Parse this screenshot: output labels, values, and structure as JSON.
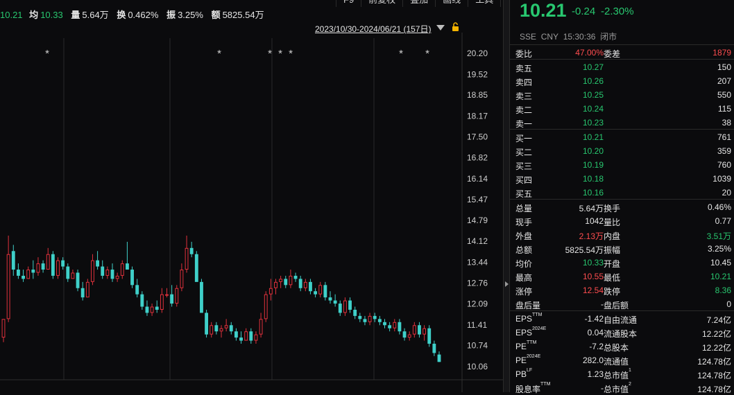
{
  "toolbar": [
    "F9",
    "前复权",
    "叠加",
    "画线",
    "工具",
    ">>"
  ],
  "stats_bar": {
    "last_value": "10.21",
    "avg_label": "均",
    "avg_value": "10.33",
    "vol_label": "量",
    "vol_value": "5.64万",
    "turnover_label": "换",
    "turnover_value": "0.462%",
    "amplitude_label": "振",
    "amplitude_value": "3.25%",
    "amount_label": "额",
    "amount_value": "5825.54万"
  },
  "date_range": "2023/10/30-2024/06/21 (157日)",
  "quote": {
    "price": "10.21",
    "change": "-0.24",
    "change_pct": "-2.30%",
    "exchange": "SSE",
    "currency": "CNY",
    "time": "15:30:36",
    "status": "闭市"
  },
  "order_book": {
    "ratio_label": "委比",
    "ratio_value": "47.00%",
    "diff_label": "委差",
    "diff_value": "1879",
    "asks": [
      {
        "label": "卖五",
        "price": "10.27",
        "volume": "150"
      },
      {
        "label": "卖四",
        "price": "10.26",
        "volume": "207"
      },
      {
        "label": "卖三",
        "price": "10.25",
        "volume": "550"
      },
      {
        "label": "卖二",
        "price": "10.24",
        "volume": "115"
      },
      {
        "label": "卖一",
        "price": "10.23",
        "volume": "38"
      }
    ],
    "bids": [
      {
        "label": "买一",
        "price": "10.21",
        "volume": "761"
      },
      {
        "label": "买二",
        "price": "10.20",
        "volume": "359"
      },
      {
        "label": "买三",
        "price": "10.19",
        "volume": "760"
      },
      {
        "label": "买四",
        "price": "10.18",
        "volume": "1039"
      },
      {
        "label": "买五",
        "price": "10.16",
        "volume": "20"
      }
    ]
  },
  "stats": [
    {
      "l1": "总量",
      "v1": "5.64万",
      "c1": "wh",
      "l2": "换手",
      "v2": "0.46%",
      "c2": "wh"
    },
    {
      "l1": "现手",
      "v1": "1042",
      "c1": "wh",
      "l2": "量比",
      "v2": "0.77",
      "c2": "wh"
    },
    {
      "l1": "外盘",
      "v1": "2.13万",
      "c1": "rd",
      "l2": "内盘",
      "v2": "3.51万",
      "c2": "gr"
    },
    {
      "l1": "总额",
      "v1": "5825.54万",
      "c1": "wh",
      "l2": "振幅",
      "v2": "3.25%",
      "c2": "wh"
    },
    {
      "l1": "均价",
      "v1": "10.33",
      "c1": "gr",
      "l2": "开盘",
      "v2": "10.45",
      "c2": "wh"
    },
    {
      "l1": "最高",
      "v1": "10.55",
      "c1": "rd",
      "l2": "最低",
      "v2": "10.21",
      "c2": "gr"
    },
    {
      "l1": "涨停",
      "v1": "12.54",
      "c1": "rd",
      "l2": "跌停",
      "v2": "8.36",
      "c2": "gr"
    },
    {
      "l1": "盘后量",
      "v1": "-",
      "c1": "wh",
      "l2": "盘后额",
      "v2": "0",
      "c2": "wh"
    }
  ],
  "fundamentals": [
    {
      "l1": "EPS",
      "s1": "TTM",
      "v1": "-1.42",
      "l2": "自由流通",
      "s2": "",
      "v2": "7.24亿"
    },
    {
      "l1": "EPS",
      "s1": "2024E",
      "v1": "0.04",
      "l2": "流通股本",
      "s2": "",
      "v2": "12.22亿"
    },
    {
      "l1": "PE",
      "s1": "TTM",
      "v1": "-7.2",
      "l2": "总股本",
      "s2": "",
      "v2": "12.22亿"
    },
    {
      "l1": "PE",
      "s1": "2024E",
      "v1": "282.0",
      "l2": "流通值",
      "s2": "",
      "v2": "124.78亿"
    },
    {
      "l1": "PB",
      "s1": "LF",
      "v1": "1.23",
      "l2": "总市值",
      "s2": "1",
      "v2": "124.78亿"
    },
    {
      "l1": "股息率",
      "s1": "TTM",
      "v1": "-",
      "l2": "总市值",
      "s2": "2",
      "v2": "124.78亿"
    }
  ],
  "chart_data": {
    "type": "candlestick",
    "y_ticks": [
      "20.20",
      "19.52",
      "18.85",
      "18.17",
      "17.50",
      "16.82",
      "16.14",
      "15.47",
      "14.79",
      "14.12",
      "13.44",
      "12.76",
      "12.09",
      "11.41",
      "10.74",
      "10.06"
    ],
    "ylim": [
      10.06,
      20.2
    ],
    "markers": [
      "*",
      "*",
      "*",
      "*",
      "*",
      "*",
      "*"
    ],
    "colors": {
      "up": "#e0313c",
      "down": "#3fd0c9",
      "grid": "#2a2a2a"
    },
    "candles": [
      [
        11.0,
        11.6,
        10.85,
        11.6
      ],
      [
        11.6,
        14.3,
        11.5,
        13.7
      ],
      [
        13.8,
        14.0,
        13.0,
        13.2
      ],
      [
        13.2,
        13.4,
        12.9,
        13.0
      ],
      [
        13.0,
        13.2,
        12.8,
        12.9
      ],
      [
        12.9,
        13.3,
        12.9,
        13.2
      ],
      [
        13.2,
        13.5,
        12.9,
        13.1
      ],
      [
        13.1,
        13.6,
        13.0,
        13.4
      ],
      [
        13.4,
        13.5,
        13.1,
        13.2
      ],
      [
        13.2,
        13.9,
        13.2,
        13.7
      ],
      [
        13.7,
        13.8,
        12.9,
        13.0
      ],
      [
        13.0,
        13.6,
        12.9,
        13.5
      ],
      [
        13.5,
        13.6,
        13.2,
        13.3
      ],
      [
        13.3,
        13.4,
        12.8,
        12.9
      ],
      [
        12.9,
        13.2,
        12.9,
        13.1
      ],
      [
        13.1,
        13.2,
        12.5,
        12.6
      ],
      [
        12.6,
        12.8,
        12.2,
        12.3
      ],
      [
        12.3,
        12.9,
        12.3,
        12.8
      ],
      [
        12.8,
        13.7,
        12.7,
        13.5
      ],
      [
        13.5,
        13.8,
        13.2,
        13.3
      ],
      [
        13.3,
        13.5,
        12.9,
        13.0
      ],
      [
        13.0,
        13.3,
        12.9,
        13.2
      ],
      [
        13.2,
        13.4,
        12.8,
        12.9
      ],
      [
        12.9,
        13.1,
        12.8,
        13.0
      ],
      [
        13.0,
        13.5,
        12.9,
        13.4
      ],
      [
        13.4,
        14.1,
        13.3,
        13.2
      ],
      [
        13.2,
        13.3,
        12.6,
        12.7
      ],
      [
        12.7,
        12.9,
        12.3,
        12.4
      ],
      [
        12.4,
        12.5,
        11.9,
        12.0
      ],
      [
        12.0,
        12.2,
        11.7,
        11.8
      ],
      [
        11.8,
        12.1,
        11.7,
        12.0
      ],
      [
        12.0,
        12.2,
        11.8,
        11.9
      ],
      [
        11.9,
        12.6,
        11.8,
        12.4
      ],
      [
        12.4,
        12.6,
        12.3,
        12.4
      ],
      [
        12.4,
        12.7,
        12.0,
        12.1
      ],
      [
        12.1,
        12.7,
        12.0,
        12.6
      ],
      [
        12.6,
        13.4,
        12.5,
        13.2
      ],
      [
        13.2,
        14.3,
        13.1,
        13.9
      ],
      [
        13.9,
        14.1,
        13.6,
        13.7
      ],
      [
        13.7,
        13.8,
        12.9,
        12.8
      ],
      [
        12.8,
        12.9,
        11.9,
        11.8
      ],
      [
        11.8,
        11.9,
        11.0,
        11.1
      ],
      [
        11.1,
        11.5,
        11.0,
        11.4
      ],
      [
        11.4,
        11.5,
        11.1,
        11.2
      ],
      [
        11.2,
        11.4,
        11.0,
        11.3
      ],
      [
        11.3,
        11.6,
        11.2,
        11.4
      ],
      [
        11.4,
        11.5,
        11.1,
        11.2
      ],
      [
        11.2,
        11.3,
        10.9,
        11.0
      ],
      [
        11.0,
        11.2,
        10.8,
        10.9
      ],
      [
        10.9,
        11.3,
        10.9,
        11.2
      ],
      [
        11.2,
        11.3,
        10.8,
        10.9
      ],
      [
        10.9,
        11.2,
        10.8,
        11.1
      ],
      [
        11.1,
        11.8,
        11.0,
        11.6
      ],
      [
        11.6,
        12.5,
        11.5,
        12.4
      ],
      [
        12.4,
        12.9,
        12.2,
        12.6
      ],
      [
        12.6,
        12.9,
        12.4,
        12.8
      ],
      [
        12.8,
        13.0,
        12.6,
        12.9
      ],
      [
        12.9,
        13.0,
        12.6,
        12.7
      ],
      [
        12.7,
        13.2,
        12.6,
        13.0
      ],
      [
        13.0,
        13.1,
        12.8,
        12.9
      ],
      [
        12.9,
        13.0,
        12.5,
        12.6
      ],
      [
        12.6,
        12.9,
        12.5,
        12.8
      ],
      [
        12.8,
        12.9,
        12.4,
        12.5
      ],
      [
        12.5,
        12.6,
        12.3,
        12.4
      ],
      [
        12.4,
        12.8,
        12.3,
        12.7
      ],
      [
        12.7,
        12.8,
        12.2,
        12.3
      ],
      [
        12.3,
        12.5,
        12.1,
        12.2
      ],
      [
        12.2,
        12.4,
        12.0,
        12.1
      ],
      [
        12.1,
        12.2,
        11.7,
        11.8
      ],
      [
        11.8,
        12.3,
        11.7,
        12.2
      ],
      [
        12.2,
        12.3,
        11.8,
        11.9
      ],
      [
        11.9,
        12.0,
        11.6,
        11.7
      ],
      [
        11.7,
        11.8,
        11.5,
        11.6
      ],
      [
        11.6,
        11.7,
        11.4,
        11.5
      ],
      [
        11.5,
        11.8,
        11.4,
        11.7
      ],
      [
        11.7,
        11.8,
        11.5,
        11.6
      ],
      [
        11.6,
        11.7,
        11.4,
        11.5
      ],
      [
        11.5,
        11.6,
        11.3,
        11.4
      ],
      [
        11.4,
        11.5,
        11.2,
        11.3
      ],
      [
        11.3,
        11.6,
        11.2,
        11.5
      ],
      [
        11.5,
        11.6,
        11.1,
        11.2
      ],
      [
        11.2,
        11.3,
        10.9,
        11.0
      ],
      [
        11.0,
        11.2,
        10.9,
        11.1
      ],
      [
        11.1,
        11.5,
        11.0,
        11.4
      ],
      [
        11.4,
        11.5,
        11.0,
        11.1
      ],
      [
        11.1,
        11.4,
        10.9,
        11.3
      ],
      [
        11.3,
        11.4,
        10.7,
        10.8
      ],
      [
        10.8,
        10.9,
        10.4,
        10.5
      ],
      [
        10.45,
        10.55,
        10.21,
        10.21
      ]
    ]
  }
}
